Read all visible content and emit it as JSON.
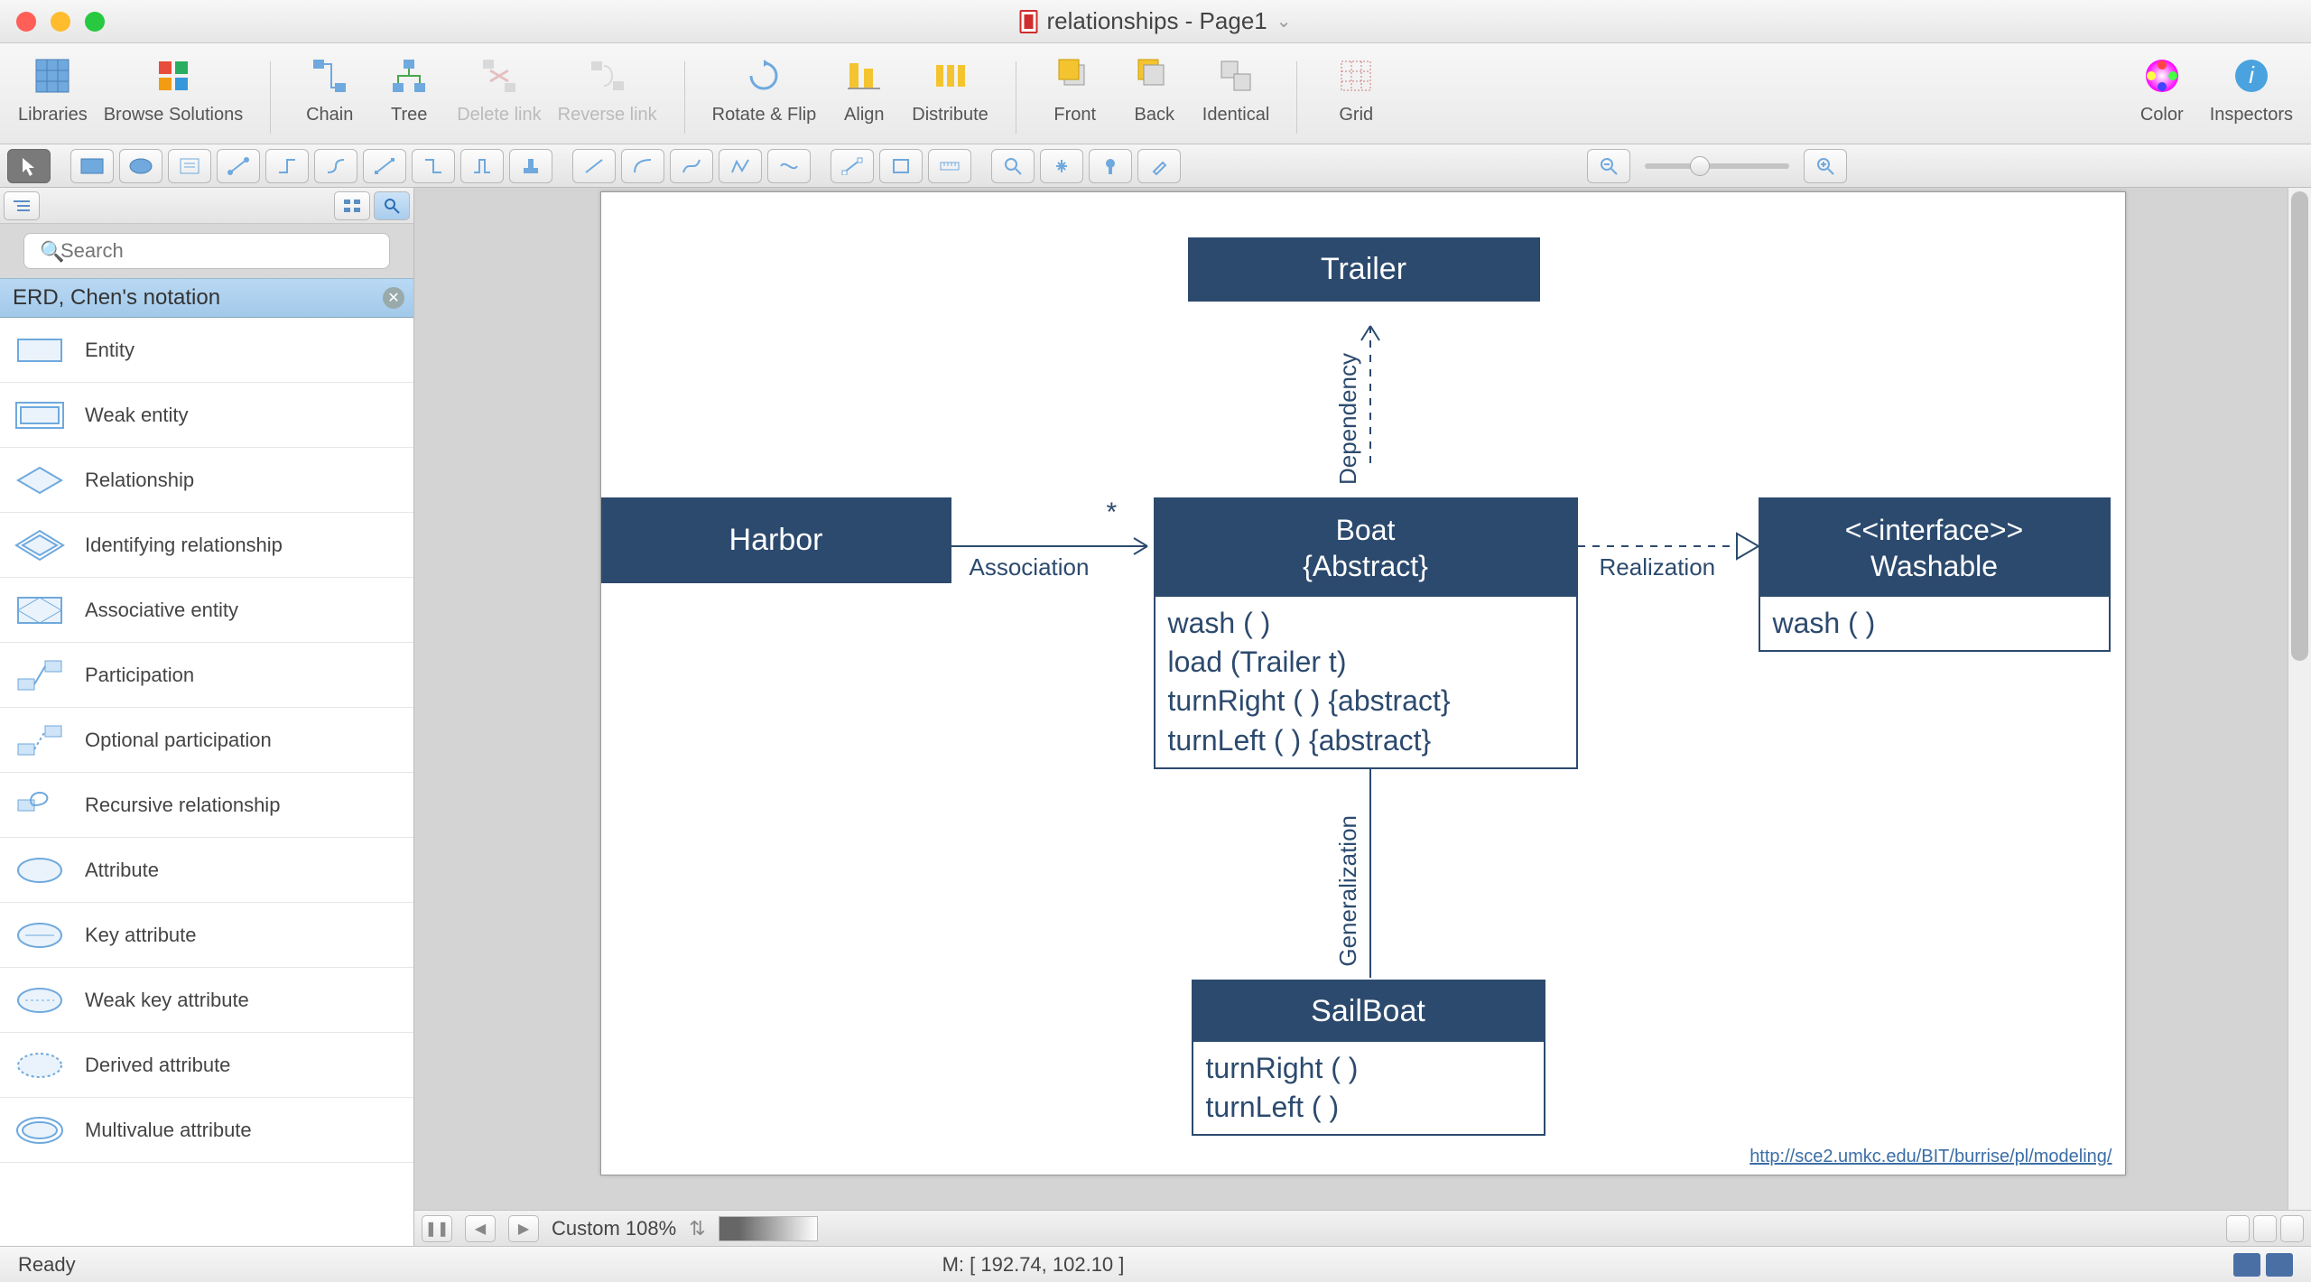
{
  "title": "relationships - Page1",
  "toolbar": [
    {
      "id": "libraries",
      "label": "Libraries"
    },
    {
      "id": "browse",
      "label": "Browse Solutions"
    },
    {
      "sep": true
    },
    {
      "id": "chain",
      "label": "Chain"
    },
    {
      "id": "tree",
      "label": "Tree"
    },
    {
      "id": "deletelink",
      "label": "Delete link",
      "disabled": true
    },
    {
      "id": "reverselink",
      "label": "Reverse link",
      "disabled": true
    },
    {
      "sep": true
    },
    {
      "id": "rotateflip",
      "label": "Rotate & Flip"
    },
    {
      "id": "align",
      "label": "Align"
    },
    {
      "id": "distribute",
      "label": "Distribute"
    },
    {
      "sep": true
    },
    {
      "id": "front",
      "label": "Front"
    },
    {
      "id": "back",
      "label": "Back"
    },
    {
      "id": "identical",
      "label": "Identical"
    },
    {
      "sep": true
    },
    {
      "id": "grid",
      "label": "Grid"
    },
    {
      "spacer": true
    },
    {
      "id": "color",
      "label": "Color"
    },
    {
      "id": "inspectors",
      "label": "Inspectors"
    }
  ],
  "search_placeholder": "Search",
  "category": "ERD, Chen's notation",
  "shapes": [
    "Entity",
    "Weak entity",
    "Relationship",
    "Identifying relationship",
    "Associative entity",
    "Participation",
    "Optional participation",
    "Recursive relationship",
    "Attribute",
    "Key attribute",
    "Weak key attribute",
    "Derived attribute",
    "Multivalue attribute"
  ],
  "diagram": {
    "trailer": {
      "title": "Trailer"
    },
    "harbor": {
      "title": "Harbor"
    },
    "boat": {
      "title": "Boat",
      "subtitle": "{Abstract}",
      "methods": [
        "wash ( )",
        "load (Trailer t)",
        "turnRight ( ) {abstract}",
        "turnLeft ( ) {abstract}"
      ]
    },
    "washable": {
      "title1": "<<interface>>",
      "title2": "Washable",
      "methods": [
        "wash ( )"
      ]
    },
    "sailboat": {
      "title": "SailBoat",
      "methods": [
        "turnRight ( )",
        "turnLeft ( )"
      ]
    },
    "labels": {
      "dependency": "Dependency",
      "association": "Association",
      "star": "*",
      "realization": "Realization",
      "generalization": "Generalization"
    },
    "credit": "http://sce2.umkc.edu/BIT/burrise/pl/modeling/"
  },
  "bottom": {
    "zoom": "Custom 108%"
  },
  "status": {
    "ready": "Ready",
    "coords": "M: [ 192.74, 102.10 ]"
  },
  "chart_data": {
    "type": "diagram",
    "notation": "UML class diagram",
    "nodes": [
      {
        "id": "Trailer",
        "kind": "class",
        "methods": []
      },
      {
        "id": "Harbor",
        "kind": "class",
        "methods": []
      },
      {
        "id": "Boat",
        "kind": "abstract class",
        "stereotype": "{Abstract}",
        "methods": [
          "wash()",
          "load(Trailer t)",
          "turnRight() {abstract}",
          "turnLeft() {abstract}"
        ]
      },
      {
        "id": "Washable",
        "kind": "interface",
        "stereotype": "<<interface>>",
        "methods": [
          "wash()"
        ]
      },
      {
        "id": "SailBoat",
        "kind": "class",
        "methods": [
          "turnRight()",
          "turnLeft()"
        ]
      }
    ],
    "edges": [
      {
        "from": "Boat",
        "to": "Trailer",
        "type": "dependency",
        "label": "Dependency"
      },
      {
        "from": "Harbor",
        "to": "Boat",
        "type": "association",
        "label": "Association",
        "multiplicity_to": "*"
      },
      {
        "from": "Boat",
        "to": "Washable",
        "type": "realization",
        "label": "Realization"
      },
      {
        "from": "SailBoat",
        "to": "Boat",
        "type": "generalization",
        "label": "Generalization"
      }
    ],
    "source_credit": "http://sce2.umkc.edu/BIT/burrise/pl/modeling/"
  }
}
